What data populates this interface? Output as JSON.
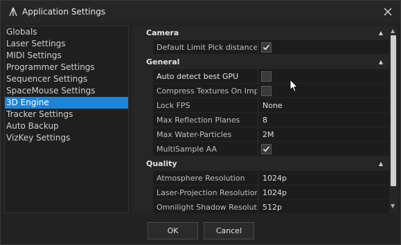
{
  "window": {
    "title": "Application Settings"
  },
  "sidebar": {
    "items": [
      {
        "label": "Globals",
        "selected": false
      },
      {
        "label": "Laser Settings",
        "selected": false
      },
      {
        "label": "MIDI Settings",
        "selected": false
      },
      {
        "label": "Programmer Settings",
        "selected": false
      },
      {
        "label": "Sequencer Settings",
        "selected": false
      },
      {
        "label": "SpaceMouse Settings",
        "selected": false
      },
      {
        "label": "3D Engine",
        "selected": true
      },
      {
        "label": "Tracker Settings",
        "selected": false
      },
      {
        "label": "Auto Backup",
        "selected": false
      },
      {
        "label": "VizKey Settings",
        "selected": false
      }
    ]
  },
  "grid": {
    "camera": {
      "header": "Camera",
      "rows": [
        {
          "label": "Default Limit Pick distance",
          "checked": true
        }
      ]
    },
    "general": {
      "header": "General",
      "rows": [
        {
          "label": "Auto detect best GPU",
          "type": "checkbox",
          "checked": false
        },
        {
          "label": "Compress Textures On Imp...",
          "type": "checkbox",
          "checked": false
        },
        {
          "label": "Lock FPS",
          "type": "text",
          "value": "None"
        },
        {
          "label": "Max Reflection Planes",
          "type": "text",
          "value": "8"
        },
        {
          "label": "Max Water-Particles",
          "type": "text",
          "value": "2M"
        },
        {
          "label": "MultiSample AA",
          "type": "checkbox",
          "checked": true
        }
      ]
    },
    "quality": {
      "header": "Quality",
      "rows": [
        {
          "label": "Atmosphere Resolution",
          "value": "1024p"
        },
        {
          "label": "Laser-Projection Resolution",
          "value": "1024p"
        },
        {
          "label": "Omnilight Shadow Resolut...",
          "value": "512p"
        }
      ]
    }
  },
  "footer": {
    "ok_label": "OK",
    "cancel_label": "Cancel"
  },
  "icons": {
    "app": "app-logo-icon",
    "close": "close-icon",
    "collapse": "chevron-up-icon",
    "check": "checkmark-icon"
  },
  "colors": {
    "accent": "#1e84d6",
    "background": "#222222"
  }
}
